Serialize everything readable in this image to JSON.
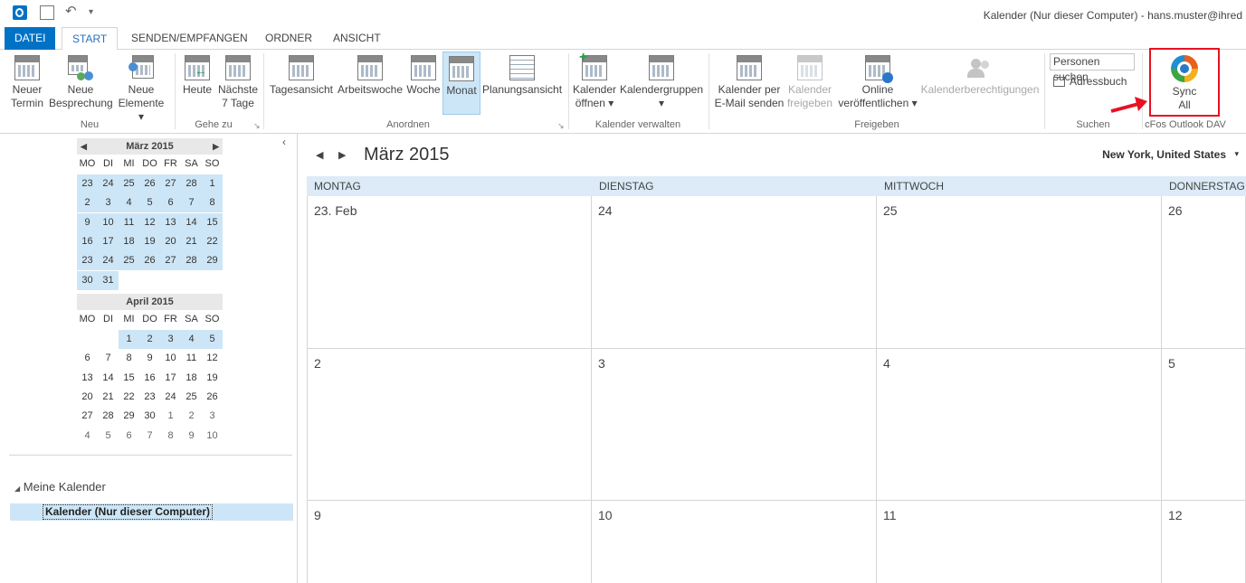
{
  "window": {
    "title": "Kalender (Nur dieser Computer) - hans.muster@ihred"
  },
  "tabs": [
    "DATEI",
    "START",
    "SENDEN/EMPFANGEN",
    "ORDNER",
    "ANSICHT"
  ],
  "ribbon": {
    "groups": {
      "neu": "Neu",
      "gehe_zu": "Gehe zu",
      "anordnen": "Anordnen",
      "kalender_verwalten": "Kalender verwalten",
      "freigeben": "Freigeben",
      "suchen": "Suchen",
      "cfos": "cFos Outlook DAV"
    },
    "buttons": {
      "neuer_termin": [
        "Neuer",
        "Termin"
      ],
      "neue_besprechung": [
        "Neue",
        "Besprechung"
      ],
      "neue_elemente": [
        "Neue",
        "Elemente ▾"
      ],
      "heute": [
        "Heute",
        ""
      ],
      "naechste7": [
        "Nächste",
        "7 Tage"
      ],
      "tagesansicht": "Tagesansicht",
      "arbeitswoche": "Arbeitswoche",
      "woche": "Woche",
      "monat": "Monat",
      "planungsansicht": "Planungsansicht",
      "kalender_oeffnen": [
        "Kalender",
        "öffnen ▾"
      ],
      "kalendergruppen": [
        "Kalendergruppen",
        "▾"
      ],
      "per_email": [
        "Kalender per",
        "E-Mail senden"
      ],
      "kal_freigeben": [
        "Kalender",
        "freigeben"
      ],
      "online": [
        "Online",
        "veröffentlichen ▾"
      ],
      "berechtigungen": "Kalenderberechtigungen",
      "personen_suchen": "Personen suchen",
      "adressbuch": "Adressbuch",
      "sync_all": [
        "Sync",
        "All"
      ]
    }
  },
  "mini_cal": {
    "march": {
      "title": "März 2015",
      "dow": [
        "MO",
        "DI",
        "MI",
        "DO",
        "FR",
        "SA",
        "SO"
      ],
      "weeks": [
        [
          "23",
          "24",
          "25",
          "26",
          "27",
          "28",
          "1"
        ],
        [
          "2",
          "3",
          "4",
          "5",
          "6",
          "7",
          "8"
        ],
        [
          "9",
          "10",
          "11",
          "12",
          "13",
          "14",
          "15"
        ],
        [
          "16",
          "17",
          "18",
          "19",
          "20",
          "21",
          "22"
        ],
        [
          "23",
          "24",
          "25",
          "26",
          "27",
          "28",
          "29"
        ],
        [
          "30",
          "31",
          "",
          "",
          "",
          "",
          ""
        ]
      ]
    },
    "april": {
      "title": "April 2015",
      "dow": [
        "MO",
        "DI",
        "MI",
        "DO",
        "FR",
        "SA",
        "SO"
      ],
      "weeks": [
        [
          "",
          "",
          "1",
          "2",
          "3",
          "4",
          "5"
        ],
        [
          "6",
          "7",
          "8",
          "9",
          "10",
          "11",
          "12"
        ],
        [
          "13",
          "14",
          "15",
          "16",
          "17",
          "18",
          "19"
        ],
        [
          "20",
          "21",
          "22",
          "23",
          "24",
          "25",
          "26"
        ],
        [
          "27",
          "28",
          "29",
          "30",
          "1",
          "2",
          "3"
        ],
        [
          "4",
          "5",
          "6",
          "7",
          "8",
          "9",
          "10"
        ]
      ]
    }
  },
  "my_calendars": {
    "header": "Meine Kalender",
    "item": "Kalender (Nur dieser Computer)"
  },
  "main": {
    "month_title": "März 2015",
    "location": "New York, United States",
    "columns": [
      "MONTAG",
      "DIENSTAG",
      "MITTWOCH",
      "DONNERSTAG"
    ],
    "rows": [
      [
        "23. Feb",
        "24",
        "25",
        "26"
      ],
      [
        "2",
        "3",
        "4",
        "5"
      ],
      [
        "9",
        "10",
        "11",
        "12"
      ]
    ]
  },
  "colors": {
    "accent": "#0072c6",
    "highlight": "#cde6f7",
    "red_box": "#e81123"
  }
}
